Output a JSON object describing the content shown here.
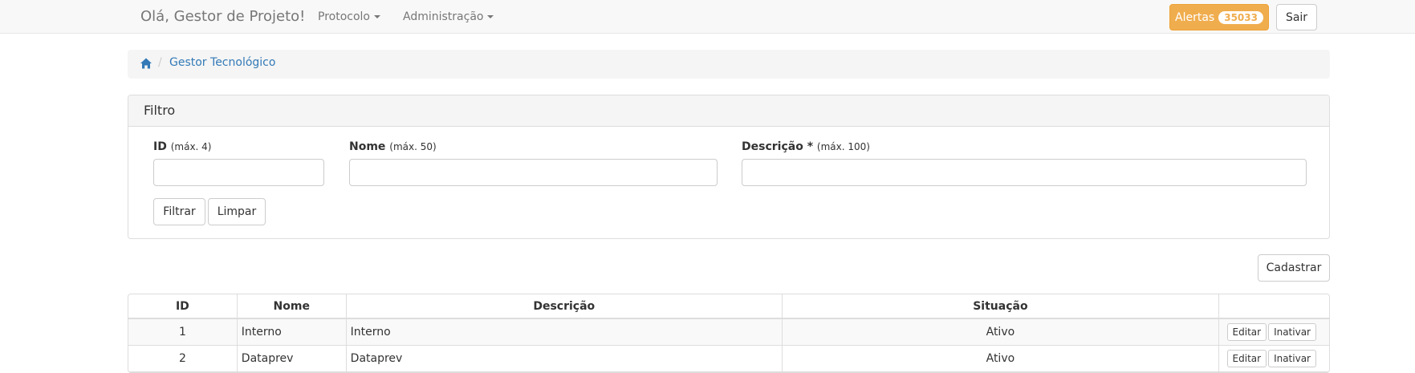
{
  "navbar": {
    "brand": "Olá, Gestor de Projeto!",
    "menus": [
      {
        "label": "Protocolo"
      },
      {
        "label": "Administração"
      }
    ],
    "alerts_label": "Alertas",
    "alerts_count": "35033",
    "logout_label": "Sair"
  },
  "breadcrumb": {
    "items": [
      "Gestor Tecnológico"
    ]
  },
  "filter": {
    "title": "Filtro",
    "fields": [
      {
        "label": "ID",
        "hint": "(máx. 4)",
        "value": ""
      },
      {
        "label": "Nome",
        "hint": "(máx. 50)",
        "value": ""
      },
      {
        "label": "Descrição *",
        "hint": "(máx. 100)",
        "value": ""
      }
    ],
    "filter_button": "Filtrar",
    "clear_button": "Limpar"
  },
  "register_button": "Cadastrar",
  "table": {
    "columns": [
      "ID",
      "Nome",
      "Descrição",
      "Situação",
      ""
    ],
    "rows": [
      {
        "id": "1",
        "nome": "Interno",
        "descricao": "Interno",
        "situacao": "Ativo",
        "edit": "Editar",
        "deactivate": "Inativar"
      },
      {
        "id": "2",
        "nome": "Dataprev",
        "descricao": "Dataprev",
        "situacao": "Ativo",
        "edit": "Editar",
        "deactivate": "Inativar"
      }
    ]
  },
  "colors": {
    "alert": "#f0ad4e",
    "link": "#337ab7",
    "navbar_bg": "#f8f8f8"
  },
  "icons": {
    "home": "home-icon"
  }
}
